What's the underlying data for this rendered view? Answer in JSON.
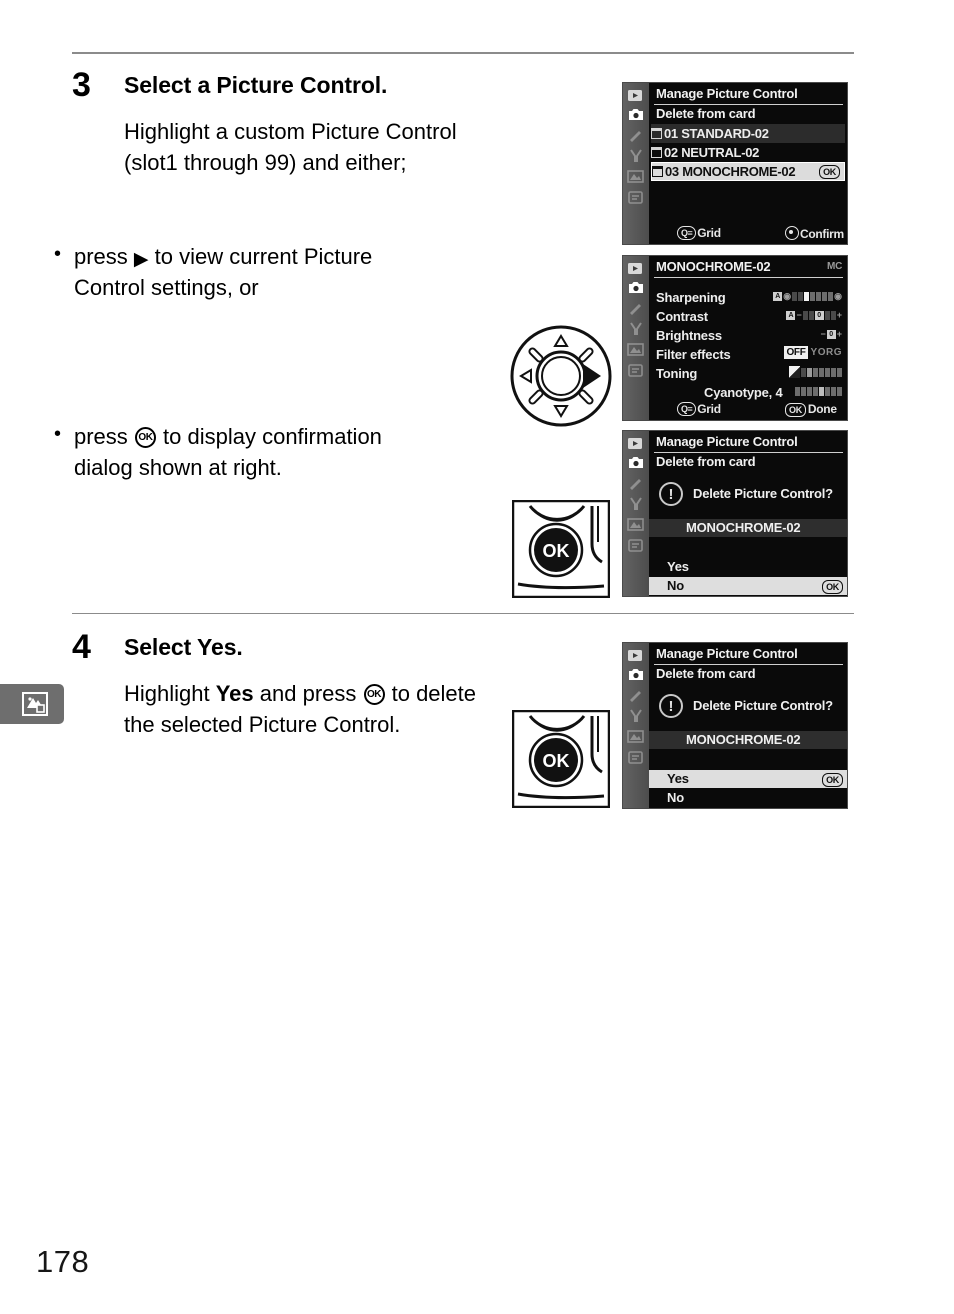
{
  "page": {
    "number": "178",
    "chapter_tab_icon": "retouch-icon"
  },
  "steps": [
    {
      "number": "3",
      "title": "Select a Picture Control.",
      "body": "Highlight a custom Picture Control (slot1 through 99) and either;",
      "bullets": [
        {
          "pre": "press ",
          "glyph": "right-arrow",
          "post": " to view current Picture Control settings, or"
        },
        {
          "pre": "press ",
          "glyph": "ok-button",
          "post": " to display confirmation dialog shown at right."
        }
      ]
    },
    {
      "number": "4",
      "title": "Select Yes.",
      "body_pre": "Highlight ",
      "body_bold": "Yes",
      "body_mid": " and press ",
      "body_glyph": "ok-button",
      "body_post": " to delete the selected Picture Control."
    }
  ],
  "illustrations": [
    {
      "name": "multi-selector-right",
      "label": ""
    },
    {
      "name": "ok-button-press-1",
      "label": "OK"
    },
    {
      "name": "ok-button-press-2",
      "label": "OK"
    }
  ],
  "screens": {
    "screen1": {
      "title": "Manage Picture Control",
      "subtitle": "Delete from card",
      "rows": [
        {
          "slot": "01",
          "name": "STANDARD-02",
          "selected": false,
          "ok": ""
        },
        {
          "slot": "02",
          "name": "NEUTRAL-02",
          "selected": false,
          "ok": ""
        },
        {
          "slot": "03",
          "name": "MONOCHROME-02",
          "selected": true,
          "ok": "OK"
        }
      ],
      "footer_left": "Grid",
      "footer_right": "Confirm"
    },
    "screen2": {
      "title": "MONOCHROME-02",
      "badge": "MC",
      "settings": [
        {
          "label": "Sharpening",
          "value": ""
        },
        {
          "label": "Contrast",
          "value": ""
        },
        {
          "label": "Brightness",
          "value": ""
        },
        {
          "label": "Filter effects",
          "value": "OFF",
          "options": "YORG"
        },
        {
          "label": "Toning",
          "value": ""
        },
        {
          "label": "Cyanotype, 4",
          "value": ""
        }
      ],
      "footer_left": "Grid",
      "footer_right": "Done",
      "footer_right_chip": "OK"
    },
    "screen3": {
      "title": "Manage Picture Control",
      "subtitle": "Delete from card",
      "question": "Delete Picture Control?",
      "target": "MONOCHROME-02",
      "options": [
        {
          "label": "Yes",
          "highlighted": false,
          "ok": ""
        },
        {
          "label": "No",
          "highlighted": true,
          "ok": "OK"
        }
      ]
    },
    "screen4": {
      "title": "Manage Picture Control",
      "subtitle": "Delete from card",
      "question": "Delete Picture Control?",
      "target": "MONOCHROME-02",
      "options": [
        {
          "label": "Yes",
          "highlighted": true,
          "ok": "OK"
        },
        {
          "label": "No",
          "highlighted": false,
          "ok": ""
        }
      ]
    }
  }
}
